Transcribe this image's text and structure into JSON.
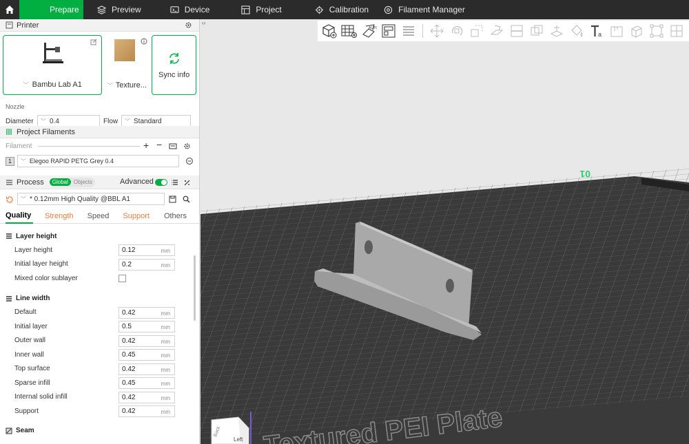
{
  "topbar": {
    "tabs": [
      {
        "label": "Prepare",
        "icon": "cube-icon",
        "active": true
      },
      {
        "label": "Preview",
        "icon": "layers-icon"
      },
      {
        "label": "Device",
        "icon": "device-icon"
      },
      {
        "label": "Project",
        "icon": "project-icon"
      },
      {
        "label": "Calibration",
        "icon": "calibration-icon"
      },
      {
        "label": "Filament Manager",
        "icon": "filament-manager-icon"
      }
    ]
  },
  "printer": {
    "section_label": "Printer",
    "printer_name": "Bambu Lab A1",
    "plate_name": "Texture...",
    "sync_label": "Sync info"
  },
  "nozzle": {
    "title": "Nozzle",
    "diameter_label": "Diameter",
    "diameter_value": "0.4",
    "flow_label": "Flow",
    "flow_value": "Standard"
  },
  "filaments": {
    "section_label": "Project Filaments",
    "filament_label": "Filament",
    "items": [
      {
        "index": "1",
        "name": "Elegoo RAPID PETG Grey 0.4"
      }
    ]
  },
  "process": {
    "section_label": "Process",
    "global_label": "Global",
    "objects_label": "Objects",
    "advanced_label": "Advanced",
    "preset": "* 0.12mm High Quality @BBL A1",
    "tabs": [
      "Quality",
      "Strength",
      "Speed",
      "Support",
      "Others"
    ]
  },
  "quality": {
    "layer_height": {
      "title": "Layer height",
      "rows": [
        {
          "label": "Layer height",
          "value": "0.12",
          "unit": "mm"
        },
        {
          "label": "Initial layer height",
          "value": "0.2",
          "unit": "mm"
        }
      ],
      "mixed_label": "Mixed color sublayer"
    },
    "line_width": {
      "title": "Line width",
      "rows": [
        {
          "label": "Default",
          "value": "0.42",
          "unit": "mm"
        },
        {
          "label": "Initial layer",
          "value": "0.5",
          "unit": "mm"
        },
        {
          "label": "Outer wall",
          "value": "0.42",
          "unit": "mm"
        },
        {
          "label": "Inner wall",
          "value": "0.45",
          "unit": "mm"
        },
        {
          "label": "Top surface",
          "value": "0.42",
          "unit": "mm"
        },
        {
          "label": "Sparse infill",
          "value": "0.45",
          "unit": "mm"
        },
        {
          "label": "Internal solid infill",
          "value": "0.42",
          "unit": "mm"
        },
        {
          "label": "Support",
          "value": "0.42",
          "unit": "mm"
        }
      ]
    },
    "seam_title": "Seam"
  },
  "viewport": {
    "plate_text": "Textured PEI Plate",
    "plate_number": "01",
    "cube_front": "Left",
    "cube_side": "Back"
  },
  "colors": {
    "accent": "#00ae42",
    "warn": "#e87d3e",
    "topbar": "#2b2b2b"
  }
}
